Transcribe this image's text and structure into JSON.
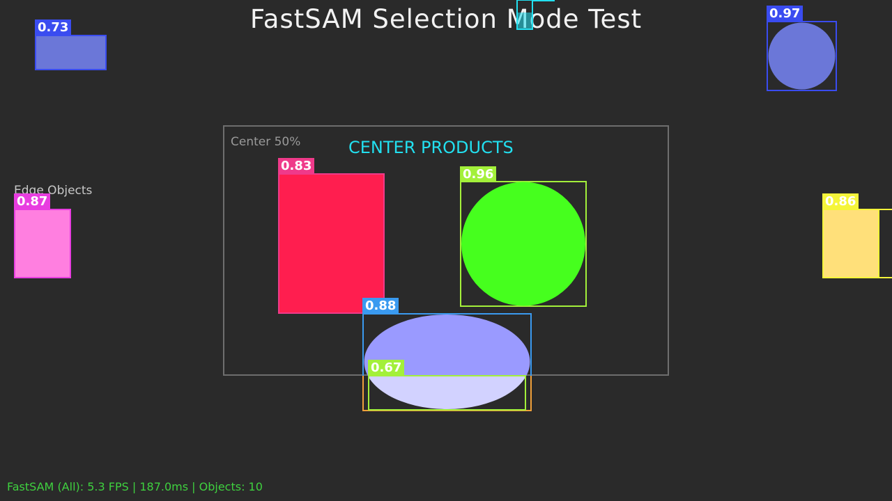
{
  "window": {
    "title": "FastSAM Selection Mode Test"
  },
  "zones": {
    "center_label": "Center 50%",
    "center_title": "CENTER PRODUCTS",
    "edge_label": "Edge Objects"
  },
  "detections": [
    {
      "id": "obj-1",
      "shape": "rectangle",
      "score": "0.73",
      "fill_color": "#6b77d8",
      "box_color": "#3a4cf0"
    },
    {
      "id": "obj-2",
      "shape": "circle",
      "score": "0.97",
      "fill_color": "#6b77d8",
      "box_color": "#3a4cf0"
    },
    {
      "id": "obj-3",
      "shape": "rectangle",
      "score": "0.87",
      "fill_color": "#ff7fe0",
      "box_color": "#e83de0"
    },
    {
      "id": "obj-4",
      "shape": "rectangle",
      "score": "0.83",
      "fill_color": "#ff1e4f",
      "box_color": "#ef3a8a"
    },
    {
      "id": "obj-5",
      "shape": "circle",
      "score": "0.96",
      "fill_color": "#46ff1e",
      "box_color": "#a3f03a"
    },
    {
      "id": "obj-6",
      "shape": "rectangle",
      "score": "0.86",
      "fill_color": "#ffe07a",
      "box_color": "#f5f53a"
    },
    {
      "id": "obj-7",
      "shape": "ellipse",
      "score": "0.88",
      "fill_color": "#9a9aff",
      "box_color": "#3a9af0"
    },
    {
      "id": "obj-8",
      "shape": "ellipse-bottom",
      "score": "0.67",
      "fill_color": "#d2d2ff",
      "box_color": "#a3f03a"
    }
  ],
  "status": {
    "text": "FastSAM (All): 5.3 FPS | 187.0ms | Objects: 10"
  }
}
